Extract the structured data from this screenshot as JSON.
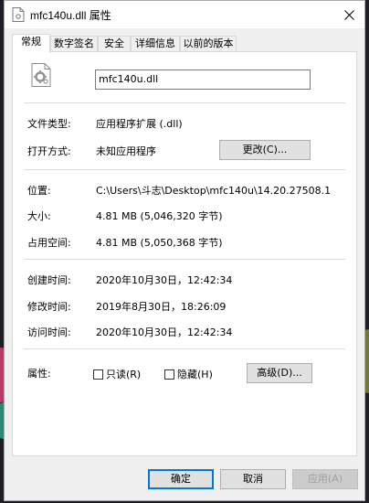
{
  "window": {
    "title": "mfc140u.dll 属性"
  },
  "tabs": [
    {
      "label": "常规",
      "active": true
    },
    {
      "label": "数字签名",
      "active": false
    },
    {
      "label": "安全",
      "active": false
    },
    {
      "label": "详细信息",
      "active": false
    },
    {
      "label": "以前的版本",
      "active": false
    }
  ],
  "general": {
    "file_name": "mfc140u.dll",
    "file_type_label": "文件类型:",
    "file_type_value": "应用程序扩展 (.dll)",
    "open_with_label": "打开方式:",
    "open_with_value": "未知应用程序",
    "change_button": "更改(C)...",
    "location_label": "位置:",
    "location_value": "C:\\Users\\斗志\\Desktop\\mfc140u\\14.20.27508.1",
    "size_label": "大小:",
    "size_value": "4.81 MB (5,046,320 字节)",
    "size_on_disk_label": "占用空间:",
    "size_on_disk_value": "4.81 MB (5,050,368 字节)",
    "created_label": "创建时间:",
    "created_value": "2020年10月30日，12:42:34",
    "modified_label": "修改时间:",
    "modified_value": "2019年8月30日，18:26:09",
    "accessed_label": "访问时间:",
    "accessed_value": "2020年10月30日，12:42:34",
    "attributes_label": "属性:",
    "readonly_label": "只读(R)",
    "readonly_checked": false,
    "hidden_label": "隐藏(H)",
    "hidden_checked": false,
    "advanced_button": "高级(D)..."
  },
  "footer": {
    "ok_button": "确定",
    "cancel_button": "取消",
    "apply_button": "应用(A)"
  },
  "colors": {
    "primary_border": "#0078d7",
    "dialog_bg": "#f0f0f0",
    "panel_bg": "#ffffff"
  }
}
